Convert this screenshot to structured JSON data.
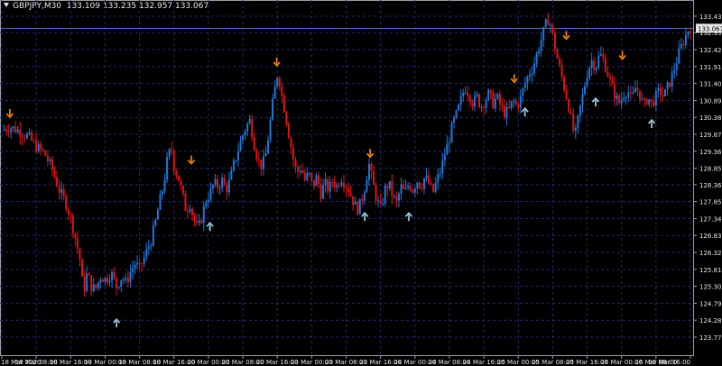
{
  "header": {
    "symbol": "GBPJPY,M30",
    "ohlc": "133.109 133.235 132.957 133.067"
  },
  "price_marker": "133.067",
  "colors": {
    "background": "#000000",
    "grid": "#1f2a6b",
    "axis_text": "#e6e6e6",
    "bull": "#1f77d9",
    "bear": "#e01414",
    "sell_arrow": "#ff8c00",
    "buy_arrow": "#a8d8f0"
  },
  "chart_data": {
    "type": "candlestick",
    "title": "GBPJPY,M30",
    "y_ticks": [
      "133.430",
      "132.935",
      "132.425",
      "131.915",
      "131.405",
      "130.895",
      "130.385",
      "129.875",
      "129.365",
      "128.855",
      "128.360",
      "127.850",
      "127.340",
      "126.830",
      "126.320",
      "125.810",
      "125.300",
      "124.790",
      "124.280",
      "123.770"
    ],
    "x_ticks": [
      "18 Mar 2020",
      "18 Mar 08:00",
      "18 Mar 16:00",
      "19 Mar 00:00",
      "19 Mar 08:00",
      "19 Mar 16:00",
      "20 Mar 00:00",
      "20 Mar 08:00",
      "20 Mar 16:00",
      "23 Mar 00:00",
      "23 Mar 08:00",
      "23 Mar 16:00",
      "24 Mar 00:00",
      "24 Mar 08:00",
      "24 Mar 16:00",
      "25 Mar 00:00",
      "25 Mar 08:00",
      "25 Mar 16:00",
      "26 Mar 00:00",
      "26 Mar 08:00",
      "26 Mar 16:00"
    ],
    "ylim": [
      123.57,
      133.65
    ],
    "close_path": [
      [
        0,
        130.0
      ],
      [
        0.6,
        130.1
      ],
      [
        1.2,
        130.0
      ],
      [
        2.0,
        129.8
      ],
      [
        2.6,
        129.5
      ],
      [
        3.2,
        129.3
      ],
      [
        3.8,
        128.8
      ],
      [
        4.3,
        128.2
      ],
      [
        4.8,
        127.8
      ],
      [
        5.2,
        127.3
      ],
      [
        5.6,
        126.6
      ],
      [
        5.9,
        126.0
      ],
      [
        6.1,
        125.1
      ],
      [
        6.4,
        125.7
      ],
      [
        6.7,
        125.3
      ],
      [
        7.0,
        125.2
      ],
      [
        7.4,
        125.6
      ],
      [
        7.8,
        125.5
      ],
      [
        8.2,
        125.7
      ],
      [
        8.6,
        125.3
      ],
      [
        9.0,
        125.6
      ],
      [
        9.3,
        125.4
      ],
      [
        9.6,
        125.7
      ],
      [
        10.0,
        126.0
      ],
      [
        10.3,
        125.8
      ],
      [
        10.6,
        126.1
      ],
      [
        10.9,
        126.4
      ],
      [
        11.2,
        126.7
      ],
      [
        11.5,
        127.2
      ],
      [
        11.8,
        127.8
      ],
      [
        12.1,
        128.3
      ],
      [
        12.4,
        129.1
      ],
      [
        12.7,
        129.5
      ],
      [
        12.9,
        128.9
      ],
      [
        13.2,
        128.6
      ],
      [
        13.5,
        128.1
      ],
      [
        13.8,
        127.6
      ],
      [
        14.1,
        127.8
      ],
      [
        14.4,
        127.3
      ],
      [
        14.7,
        127.0
      ],
      [
        15.0,
        127.4
      ],
      [
        15.3,
        127.9
      ],
      [
        15.6,
        128.1
      ],
      [
        15.9,
        128.4
      ],
      [
        16.2,
        128.3
      ],
      [
        16.5,
        128.5
      ],
      [
        16.8,
        128.2
      ],
      [
        17.1,
        128.5
      ],
      [
        17.4,
        129.0
      ],
      [
        17.7,
        129.4
      ],
      [
        18.0,
        129.8
      ],
      [
        18.3,
        130.1
      ],
      [
        18.6,
        130.3
      ],
      [
        18.9,
        129.6
      ],
      [
        19.2,
        129.1
      ],
      [
        19.5,
        128.9
      ],
      [
        19.8,
        129.3
      ],
      [
        20.1,
        130.2
      ],
      [
        20.4,
        131.1
      ],
      [
        20.7,
        131.8
      ],
      [
        20.9,
        131.2
      ],
      [
        21.2,
        130.6
      ],
      [
        21.5,
        129.9
      ],
      [
        21.8,
        129.2
      ],
      [
        22.1,
        128.7
      ],
      [
        22.4,
        128.9
      ],
      [
        22.7,
        128.5
      ],
      [
        23.0,
        128.7
      ],
      [
        23.3,
        128.3
      ],
      [
        23.6,
        128.6
      ],
      [
        23.9,
        128.1
      ],
      [
        24.2,
        128.4
      ],
      [
        24.5,
        128.2
      ],
      [
        24.8,
        128.5
      ],
      [
        25.1,
        128.3
      ],
      [
        25.4,
        128.6
      ],
      [
        25.7,
        128.4
      ],
      [
        26.0,
        128.2
      ],
      [
        26.3,
        127.9
      ],
      [
        26.6,
        127.6
      ],
      [
        26.9,
        127.8
      ],
      [
        27.2,
        128.3
      ],
      [
        27.5,
        129.0
      ],
      [
        27.8,
        128.4
      ],
      [
        28.1,
        127.9
      ],
      [
        28.4,
        127.6
      ],
      [
        28.7,
        128.2
      ],
      [
        29.0,
        128.4
      ],
      [
        29.3,
        128.0
      ],
      [
        29.6,
        127.8
      ],
      [
        29.9,
        128.3
      ],
      [
        30.2,
        128.1
      ],
      [
        30.5,
        128.4
      ],
      [
        30.8,
        128.2
      ],
      [
        31.1,
        128.5
      ],
      [
        31.4,
        128.3
      ],
      [
        31.7,
        128.6
      ],
      [
        32.0,
        128.4
      ],
      [
        32.3,
        128.1
      ],
      [
        32.6,
        128.5
      ],
      [
        32.9,
        128.8
      ],
      [
        33.2,
        129.3
      ],
      [
        33.5,
        129.7
      ],
      [
        33.8,
        130.2
      ],
      [
        34.1,
        130.5
      ],
      [
        34.4,
        130.9
      ],
      [
        34.7,
        131.3
      ],
      [
        35.0,
        131.1
      ],
      [
        35.3,
        130.8
      ],
      [
        35.6,
        131.0
      ],
      [
        35.9,
        130.7
      ],
      [
        36.2,
        130.9
      ],
      [
        36.5,
        131.1
      ],
      [
        36.8,
        130.8
      ],
      [
        37.1,
        131.0
      ],
      [
        37.4,
        130.7
      ],
      [
        37.7,
        130.5
      ],
      [
        38.0,
        130.6
      ],
      [
        38.3,
        130.9
      ],
      [
        38.6,
        130.7
      ],
      [
        38.9,
        131.0
      ],
      [
        39.2,
        131.4
      ],
      [
        39.5,
        131.7
      ],
      [
        39.8,
        131.9
      ],
      [
        40.1,
        132.3
      ],
      [
        40.4,
        132.7
      ],
      [
        40.7,
        133.1
      ],
      [
        41.0,
        133.4
      ],
      [
        41.3,
        132.8
      ],
      [
        41.6,
        132.2
      ],
      [
        41.9,
        131.7
      ],
      [
        42.2,
        131.2
      ],
      [
        42.5,
        130.7
      ],
      [
        42.8,
        130.0
      ],
      [
        43.0,
        129.9
      ],
      [
        43.3,
        130.6
      ],
      [
        43.6,
        131.2
      ],
      [
        43.9,
        131.8
      ],
      [
        44.2,
        132.1
      ],
      [
        44.5,
        131.9
      ],
      [
        44.8,
        132.3
      ],
      [
        45.1,
        132.1
      ],
      [
        45.4,
        131.7
      ],
      [
        45.7,
        131.3
      ],
      [
        46.0,
        131.0
      ],
      [
        46.3,
        130.8
      ],
      [
        46.6,
        131.1
      ],
      [
        46.9,
        131.2
      ],
      [
        47.2,
        130.9
      ],
      [
        47.5,
        131.3
      ],
      [
        47.8,
        131.1
      ],
      [
        48.1,
        130.7
      ],
      [
        48.4,
        131.0
      ],
      [
        48.7,
        130.8
      ],
      [
        49.0,
        131.0
      ],
      [
        49.3,
        131.2
      ],
      [
        49.6,
        131.0
      ],
      [
        49.9,
        131.3
      ],
      [
        50.2,
        131.6
      ],
      [
        50.5,
        132.0
      ],
      [
        50.8,
        132.4
      ],
      [
        51.1,
        132.7
      ],
      [
        51.4,
        133.0
      ],
      [
        51.6,
        133.1
      ]
    ],
    "arrows_down": [
      [
        0.6,
        130.5
      ],
      [
        14.2,
        129.1
      ],
      [
        20.6,
        132.05
      ],
      [
        27.6,
        129.3
      ],
      [
        38.4,
        131.55
      ],
      [
        42.3,
        132.85
      ],
      [
        46.5,
        132.25
      ]
    ],
    "arrows_up": [
      [
        8.6,
        124.2
      ],
      [
        15.6,
        127.1
      ],
      [
        27.2,
        127.4
      ],
      [
        30.5,
        127.4
      ],
      [
        39.2,
        130.55
      ],
      [
        44.5,
        130.85
      ],
      [
        48.7,
        130.2
      ]
    ]
  }
}
